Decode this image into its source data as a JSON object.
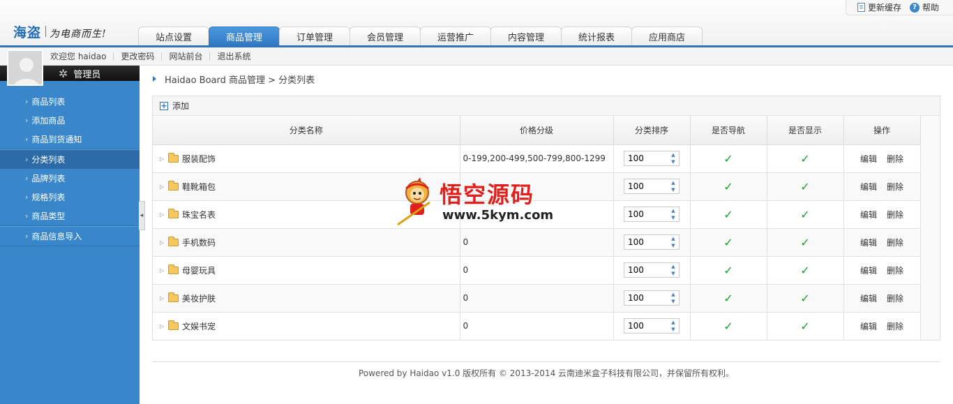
{
  "header": {
    "logo_main": "海盗",
    "logo_slogan": "为电商而生!",
    "toplinks": {
      "cache": "更新缓存",
      "help": "帮助"
    },
    "tabs": [
      {
        "label": "站点设置"
      },
      {
        "label": "商品管理"
      },
      {
        "label": "订单管理"
      },
      {
        "label": "会员管理"
      },
      {
        "label": "运营推广"
      },
      {
        "label": "内容管理"
      },
      {
        "label": "统计报表"
      },
      {
        "label": "应用商店"
      }
    ]
  },
  "userbar": {
    "welcome": "欢迎您 haidao",
    "change_password": "更改密码",
    "front_site": "网站前台",
    "logout": "退出系统"
  },
  "sidebar": {
    "role": "管理员",
    "groups": [
      [
        {
          "label": "商品列表"
        },
        {
          "label": "添加商品"
        },
        {
          "label": "商品到货通知"
        }
      ],
      [
        {
          "label": "分类列表"
        },
        {
          "label": "品牌列表"
        },
        {
          "label": "规格列表"
        },
        {
          "label": "商品类型"
        }
      ],
      [
        {
          "label": "商品信息导入"
        }
      ]
    ],
    "active": "分类列表"
  },
  "breadcrumb": "Haidao Board 商品管理 > 分类列表",
  "toolbar": {
    "add": "添加"
  },
  "table": {
    "headers": {
      "name": "分类名称",
      "price": "价格分级",
      "sort": "分类排序",
      "nav": "是否导航",
      "show": "是否显示",
      "op": "操作"
    },
    "edit_label": "编辑",
    "delete_label": "删除",
    "check_mark": "✓",
    "rows": [
      {
        "name": "服装配饰",
        "price": "0-199,200-499,500-799,800-1299",
        "sort": "100",
        "nav": true,
        "show": true
      },
      {
        "name": "鞋靴箱包",
        "price": "",
        "sort": "100",
        "nav": true,
        "show": true
      },
      {
        "name": "珠宝名表",
        "price": "",
        "sort": "100",
        "nav": true,
        "show": true
      },
      {
        "name": "手机数码",
        "price": "0",
        "sort": "100",
        "nav": true,
        "show": true
      },
      {
        "name": "母婴玩具",
        "price": "0",
        "sort": "100",
        "nav": true,
        "show": true
      },
      {
        "name": "美妆护肤",
        "price": "0",
        "sort": "100",
        "nav": true,
        "show": true
      },
      {
        "name": "文娱书宠",
        "price": "0",
        "sort": "100",
        "nav": true,
        "show": true
      }
    ]
  },
  "watermark": {
    "title": "悟空源码",
    "url": "www.5kym.com"
  },
  "footer": "Powered by Haidao v1.0 版权所有 © 2013-2014 云南迪米盒子科技有限公司，并保留所有权利。",
  "colors": {
    "accent": "#2f78c3",
    "sidebar": "#3a86ca",
    "check": "#1c9c2c",
    "watermark": "#e0201d"
  }
}
